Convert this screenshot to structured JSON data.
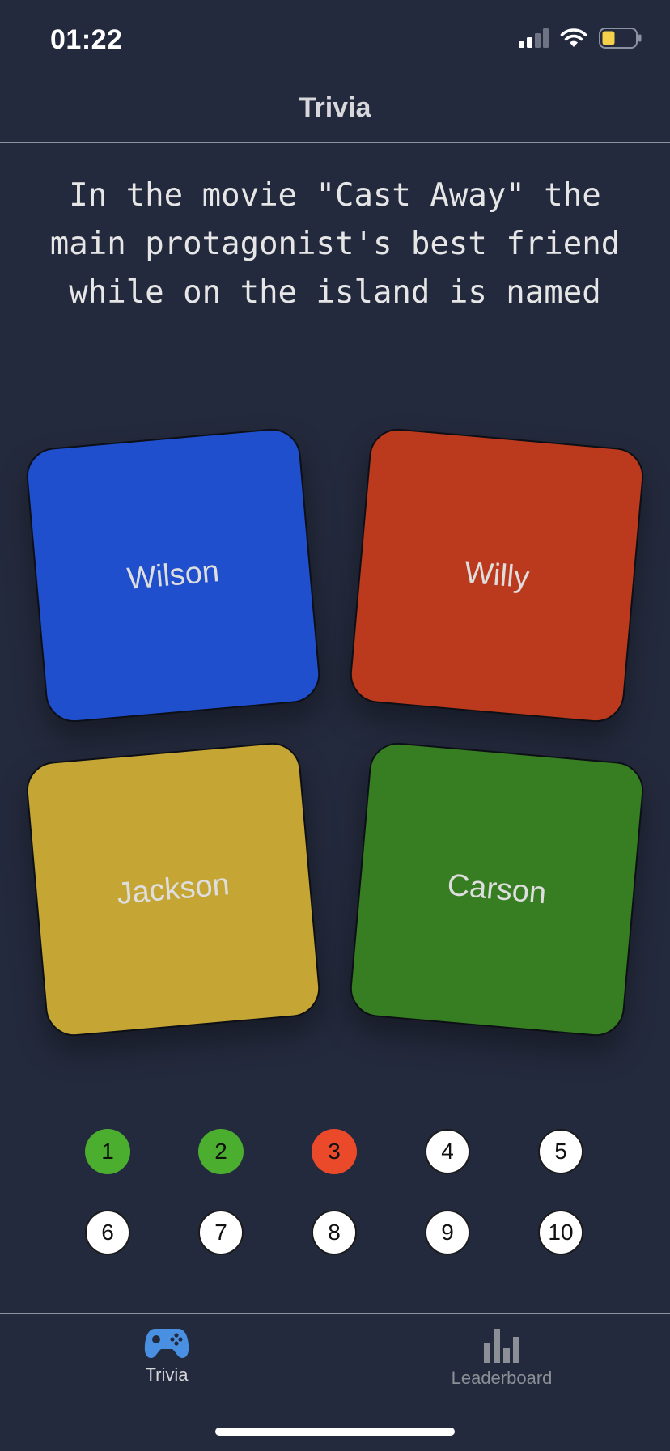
{
  "status_bar": {
    "time": "01:22",
    "signal_icon": "cellular-signal-icon",
    "wifi_icon": "wifi-icon",
    "battery_icon": "battery-icon",
    "battery_color": "#f5d04a"
  },
  "header": {
    "title": "Trivia"
  },
  "question": {
    "text": "In the movie \"Cast Away\" the main protagonist's best friend while on the island is named"
  },
  "answers": [
    {
      "label": "Wilson",
      "color": "#1f4fcc"
    },
    {
      "label": "Willy",
      "color": "#bb3a1d"
    },
    {
      "label": "Jackson",
      "color": "#c5a635"
    },
    {
      "label": "Carson",
      "color": "#377d22"
    }
  ],
  "progress": [
    {
      "number": "1",
      "state": "correct"
    },
    {
      "number": "2",
      "state": "correct"
    },
    {
      "number": "3",
      "state": "wrong"
    },
    {
      "number": "4",
      "state": "unanswered"
    },
    {
      "number": "5",
      "state": "unanswered"
    },
    {
      "number": "6",
      "state": "unanswered"
    },
    {
      "number": "7",
      "state": "unanswered"
    },
    {
      "number": "8",
      "state": "unanswered"
    },
    {
      "number": "9",
      "state": "unanswered"
    },
    {
      "number": "10",
      "state": "unanswered"
    }
  ],
  "colors": {
    "background": "#242a3d",
    "correct": "#4cae2e",
    "wrong": "#ea4a2a",
    "active_tab": "#4a90e2",
    "inactive_tab": "#8d8f96"
  },
  "tab_bar": {
    "tabs": [
      {
        "label": "Trivia",
        "icon": "gamepad-icon",
        "active": true
      },
      {
        "label": "Leaderboard",
        "icon": "bar-chart-icon",
        "active": false
      }
    ]
  }
}
